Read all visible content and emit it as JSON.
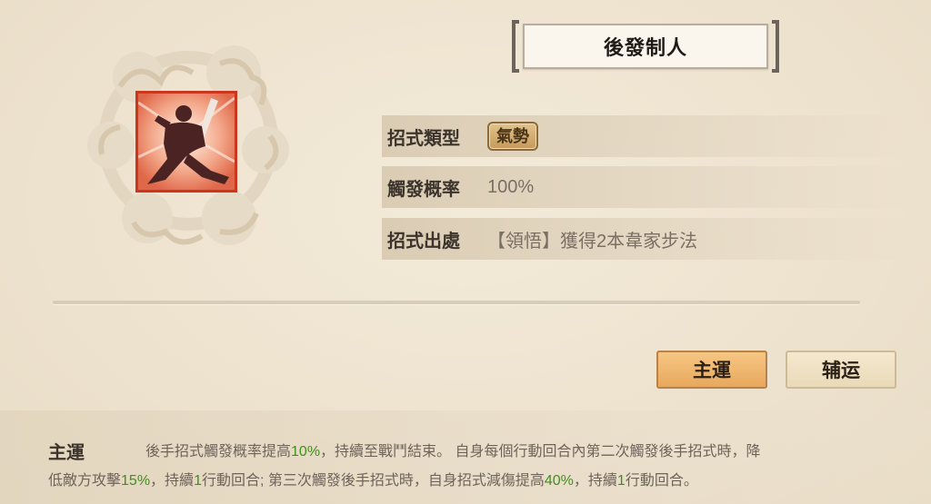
{
  "skill": {
    "name": "後發制人",
    "type_label": "招式類型",
    "type_tag": "氣勢",
    "trigger_label": "觸發概率",
    "trigger_value": "100%",
    "source_label": "招式出處",
    "source_value": "【領悟】獲得2本韋家步法"
  },
  "buttons": {
    "main": "主運",
    "aux": "辅运"
  },
  "description": {
    "title": "主運",
    "line1": [
      {
        "t": "後手招式觸發概率提高",
        "hl": false
      },
      {
        "t": "10%",
        "hl": true
      },
      {
        "t": "，持續至戰鬥結束。 自身每個行動回合內第二次觸發後手招式時，降",
        "hl": false
      }
    ],
    "line2": [
      {
        "t": "低敵方攻擊",
        "hl": false
      },
      {
        "t": "15%",
        "hl": true
      },
      {
        "t": "，持續",
        "hl": false
      },
      {
        "t": "1",
        "hl": true
      },
      {
        "t": "行動回合; 第三次觸發後手招式時，自身招式減傷提高",
        "hl": false
      },
      {
        "t": "40%",
        "hl": true
      },
      {
        "t": "，持續",
        "hl": false
      },
      {
        "t": "1",
        "hl": true
      },
      {
        "t": "行動回合。",
        "hl": false
      }
    ]
  },
  "colors": {
    "highlight": "#3f8f1b",
    "main_button": "#f0b56f",
    "icon_border": "#c9371f"
  },
  "icons": {
    "emblem": "cloud-emblem-icon",
    "skill": "warrior-stance-icon"
  }
}
